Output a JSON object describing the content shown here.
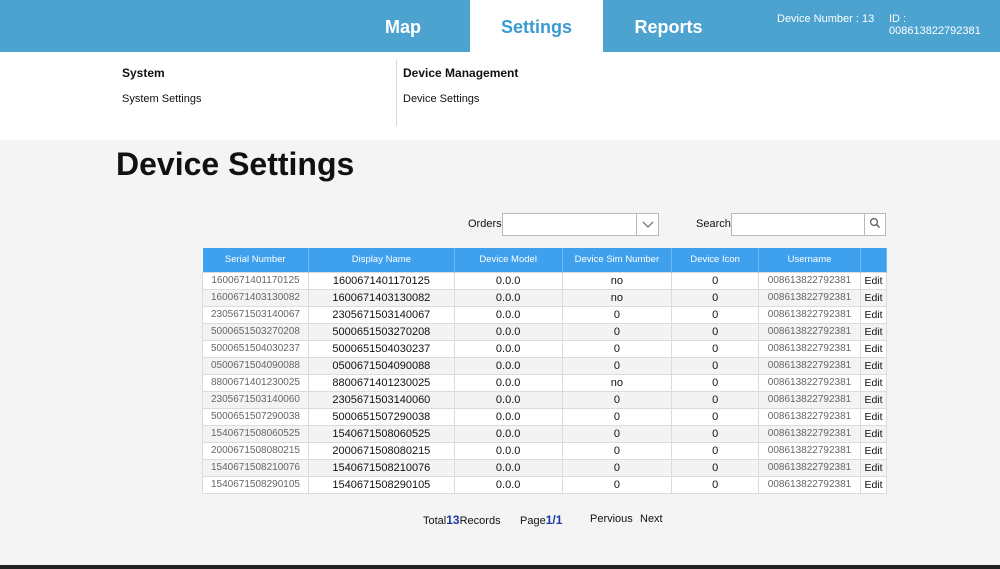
{
  "nav": {
    "tabs": [
      {
        "label": "Map"
      },
      {
        "label": "Settings"
      },
      {
        "label": "Reports"
      }
    ],
    "device_number": "Device Number : 13",
    "device_id": "ID : 008613822792381"
  },
  "submenu": {
    "system": {
      "title": "System",
      "link": "System Settings"
    },
    "device_management": {
      "title": "Device Management",
      "link": "Device Settings"
    }
  },
  "page": {
    "title": "Device Settings"
  },
  "filters": {
    "orders_label": "Orders",
    "search_label": "Search"
  },
  "table": {
    "columns": [
      "Serial Number",
      "Display Name",
      "Device Model",
      "Device Sim Number",
      "Device Icon",
      "Username",
      ""
    ],
    "edit_label": "Edit",
    "rows": [
      [
        "1600671401170125",
        "1600671401170125",
        "0.0.0",
        "no",
        "0",
        "008613822792381"
      ],
      [
        "1600671403130082",
        "1600671403130082",
        "0.0.0",
        "no",
        "0",
        "008613822792381"
      ],
      [
        "2305671503140067",
        "2305671503140067",
        "0.0.0",
        "0",
        "0",
        "008613822792381"
      ],
      [
        "5000651503270208",
        "5000651503270208",
        "0.0.0",
        "0",
        "0",
        "008613822792381"
      ],
      [
        "5000651504030237",
        "5000651504030237",
        "0.0.0",
        "0",
        "0",
        "008613822792381"
      ],
      [
        "0500671504090088",
        "0500671504090088",
        "0.0.0",
        "0",
        "0",
        "008613822792381"
      ],
      [
        "8800671401230025",
        "8800671401230025",
        "0.0.0",
        "no",
        "0",
        "008613822792381"
      ],
      [
        "2305671503140060",
        "2305671503140060",
        "0.0.0",
        "0",
        "0",
        "008613822792381"
      ],
      [
        "5000651507290038",
        "5000651507290038",
        "0.0.0",
        "0",
        "0",
        "008613822792381"
      ],
      [
        "1540671508060525",
        "1540671508060525",
        "0.0.0",
        "0",
        "0",
        "008613822792381"
      ],
      [
        "2000671508080215",
        "2000671508080215",
        "0.0.0",
        "0",
        "0",
        "008613822792381"
      ],
      [
        "1540671508210076",
        "1540671508210076",
        "0.0.0",
        "0",
        "0",
        "008613822792381"
      ],
      [
        "1540671508290105",
        "1540671508290105",
        "0.0.0",
        "0",
        "0",
        "008613822792381"
      ]
    ]
  },
  "pager": {
    "total_prefix": "Total",
    "total_count": "13",
    "total_suffix": "Records",
    "page_prefix": "Page",
    "page_value": "1/1",
    "previous": "Pervious",
    "next": "Next"
  }
}
